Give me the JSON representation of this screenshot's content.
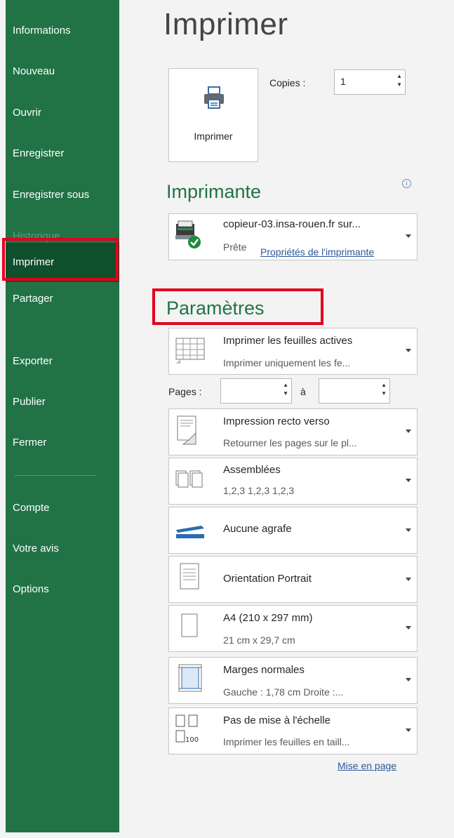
{
  "sidebar": {
    "items": [
      {
        "label": "Informations"
      },
      {
        "label": "Nouveau"
      },
      {
        "label": "Ouvrir"
      },
      {
        "label": "Enregistrer"
      },
      {
        "label": "Enregistrer sous"
      },
      {
        "label": "Historique"
      },
      {
        "label": "Imprimer"
      },
      {
        "label": "Partager"
      },
      {
        "label": "Exporter"
      },
      {
        "label": "Publier"
      },
      {
        "label": "Fermer"
      },
      {
        "label": "Compte"
      },
      {
        "label": "Votre avis"
      },
      {
        "label": "Options"
      }
    ],
    "active": "Imprimer",
    "disabled": "Historique"
  },
  "main": {
    "title": "Imprimer",
    "print_button": "Imprimer",
    "copies": {
      "label": "Copies :",
      "value": "1"
    },
    "printer": {
      "section_title": "Imprimante",
      "name": "copieur-03.insa-rouen.fr sur...",
      "status": "Prête",
      "properties_link": "Propriétés de l'imprimante"
    },
    "settings": {
      "section_title": "Paramètres",
      "scope": {
        "line1": "Imprimer les feuilles actives",
        "line2": "Imprimer uniquement les fe..."
      },
      "pages": {
        "label": "Pages :",
        "to_label": "à",
        "from_value": "",
        "to_value": ""
      },
      "duplex": {
        "line1": "Impression recto verso",
        "line2": "Retourner les pages sur le pl..."
      },
      "collate": {
        "line1": "Assemblées",
        "line2": "1,2,3    1,2,3    1,2,3"
      },
      "staple": {
        "line1": "Aucune agrafe"
      },
      "orientation": {
        "line1": "Orientation Portrait"
      },
      "paper": {
        "line1": "A4 (210 x 297 mm)",
        "line2": "21 cm x 29,7 cm"
      },
      "margins": {
        "line1": "Marges normales",
        "line2": "Gauche : 1,78 cm    Droite :..."
      },
      "scaling": {
        "line1": "Pas de mise à l'échelle",
        "line2": "Imprimer les feuilles en taill...",
        "icon_text": "100"
      },
      "page_setup_link": "Mise en page"
    }
  },
  "colors": {
    "sidebar": "#217346",
    "active": "#0f4f2c",
    "highlight": "#e3001b",
    "accent": "#217346",
    "link": "#2b579a"
  }
}
